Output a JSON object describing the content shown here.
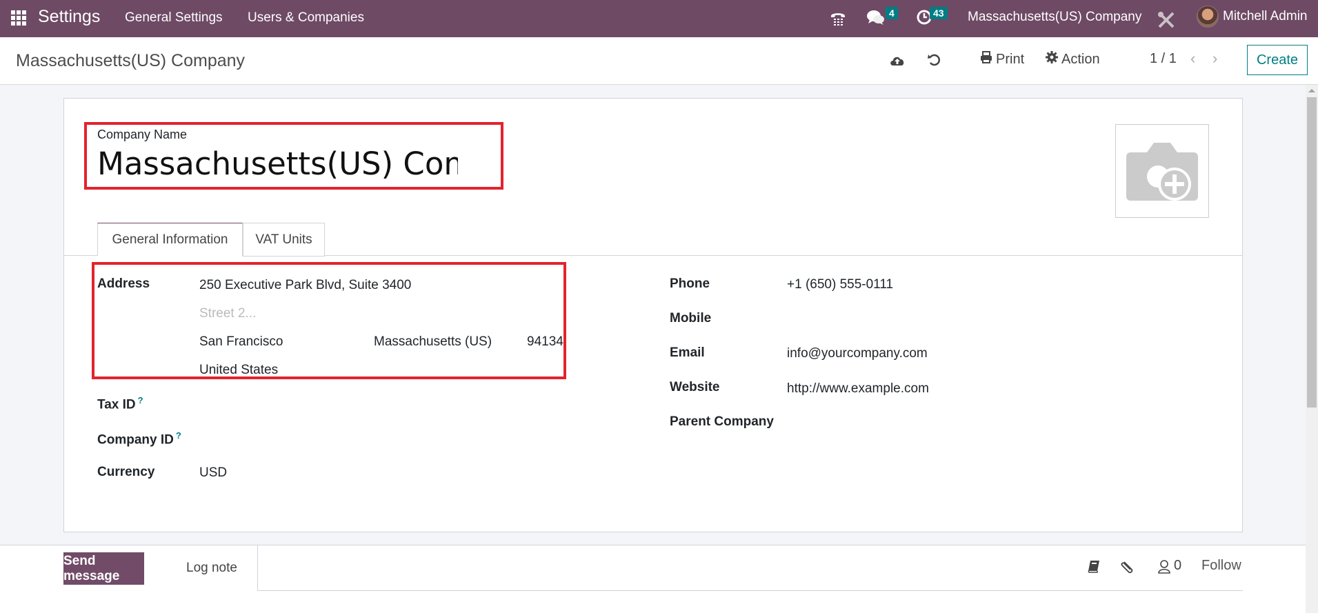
{
  "navbar": {
    "app_title": "Settings",
    "menu": [
      "General Settings",
      "Users & Companies"
    ],
    "messages_count": "4",
    "activities_count": "43",
    "company": "Massachusetts(US) Company",
    "user": "Mitchell Admin"
  },
  "control_panel": {
    "breadcrumb": "Massachusetts(US) Company",
    "print_label": "Print",
    "action_label": "Action",
    "pager": "1 / 1",
    "create_label": "Create"
  },
  "form": {
    "company_name_label": "Company Name",
    "company_name_value": "Massachusetts(US) Company",
    "tabs": [
      {
        "label": "General Information",
        "active": true
      },
      {
        "label": "VAT Units",
        "active": false
      }
    ],
    "left": {
      "address_label": "Address",
      "street": "250 Executive Park Blvd, Suite 3400",
      "street2_placeholder": "Street 2...",
      "city": "San Francisco",
      "state": "Massachusetts (US)",
      "zip": "94134",
      "country": "United States",
      "tax_id_label": "Tax ID",
      "company_id_label": "Company ID",
      "help_mark": "?",
      "currency_label": "Currency",
      "currency_value": "USD"
    },
    "right": {
      "phone_label": "Phone",
      "phone_value": "+1 (650) 555-0111",
      "mobile_label": "Mobile",
      "mobile_value": "",
      "email_label": "Email",
      "email_value": "info@yourcompany.com",
      "website_label": "Website",
      "website_value": "http://www.example.com",
      "parent_company_label": "Parent Company",
      "parent_company_value": ""
    }
  },
  "chatter": {
    "send_message_label": "Send message",
    "log_note_label": "Log note",
    "follower_count": "0",
    "follow_label": "Follow"
  },
  "colors": {
    "navbar": "#6e4a65",
    "primary": "#714b67",
    "accent": "#017e84",
    "highlight": "#e3232c"
  }
}
